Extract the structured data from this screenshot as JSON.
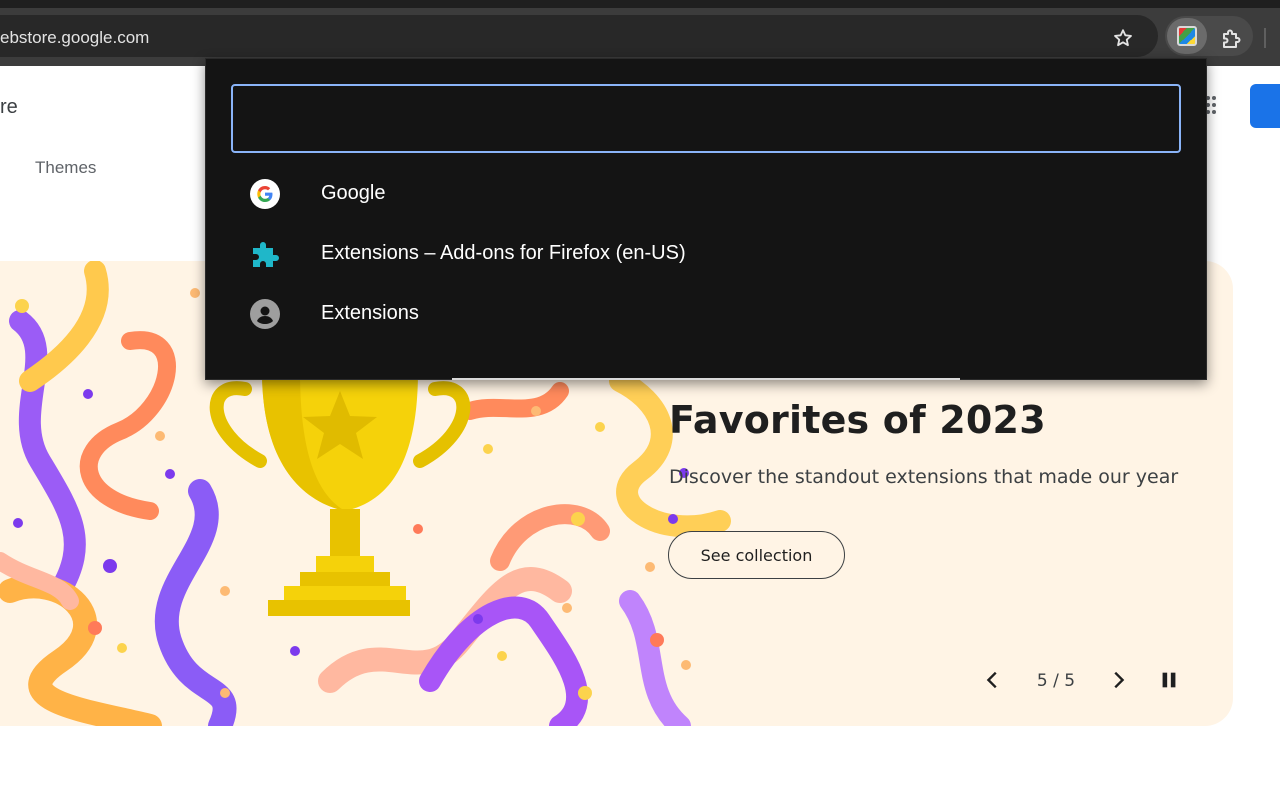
{
  "browser": {
    "url": "ebstore.google.com"
  },
  "page": {
    "store_title": "re",
    "nav": {
      "themes": "Themes"
    },
    "banner": {
      "title": "Favorites of 2023",
      "description": "Discover the standout extensions that made our year",
      "cta": "See collection",
      "counter": "5 / 5"
    }
  },
  "popup": {
    "input_value": "",
    "suggestions": [
      {
        "label": "Google",
        "icon": "google-icon"
      },
      {
        "label": "Extensions – Add-ons for Firefox (en-US)",
        "icon": "puzzle-icon"
      },
      {
        "label": "Extensions",
        "icon": "account-icon"
      }
    ]
  },
  "colors": {
    "chrome_dark": "#3c3c3c",
    "popup_bg": "#141414",
    "focus_ring": "#8ab4f8",
    "banner_bg": "#fff4e5",
    "accent_blue": "#1a73e8"
  }
}
